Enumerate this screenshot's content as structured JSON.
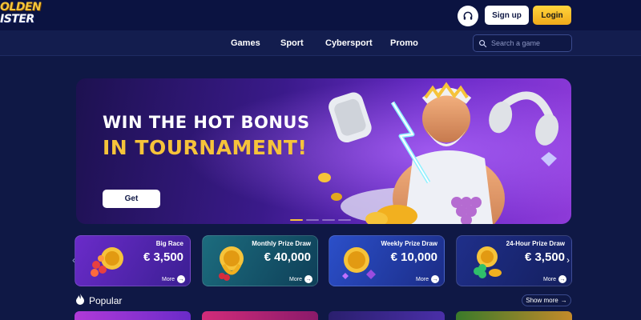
{
  "header": {
    "logo_line1": "OLDEN",
    "logo_line2": "ISTER",
    "support_icon": "headset-icon",
    "signup_label": "Sign up",
    "login_label": "Login"
  },
  "nav": {
    "items": [
      {
        "label": "Games"
      },
      {
        "label": "Sport"
      },
      {
        "label": "Cybersport"
      },
      {
        "label": "Promo"
      }
    ],
    "search_placeholder": "Search a game",
    "search_icon": "search-icon"
  },
  "banner": {
    "title_line1": "WIN THE HOT BONUS",
    "title_line2": "IN TOURNAMENT!",
    "cta_label": "Get",
    "slide_count": 4,
    "active_slide": 1
  },
  "promos": [
    {
      "title": "Big Race",
      "amount": "€ 3,500",
      "more": "More"
    },
    {
      "title": "Monthly Prize Draw",
      "amount": "€ 40,000",
      "more": "More"
    },
    {
      "title": "Weekly Prize Draw",
      "amount": "€ 10,000",
      "more": "More"
    },
    {
      "title": "24-Hour Prize Draw",
      "amount": "€ 3,500",
      "more": "More"
    }
  ],
  "popular": {
    "title": "Popular",
    "show_more": "Show more"
  },
  "colors": {
    "background": "#0f1845",
    "accent_gold": "#f6c33a",
    "login_button": "#ffd53d"
  }
}
